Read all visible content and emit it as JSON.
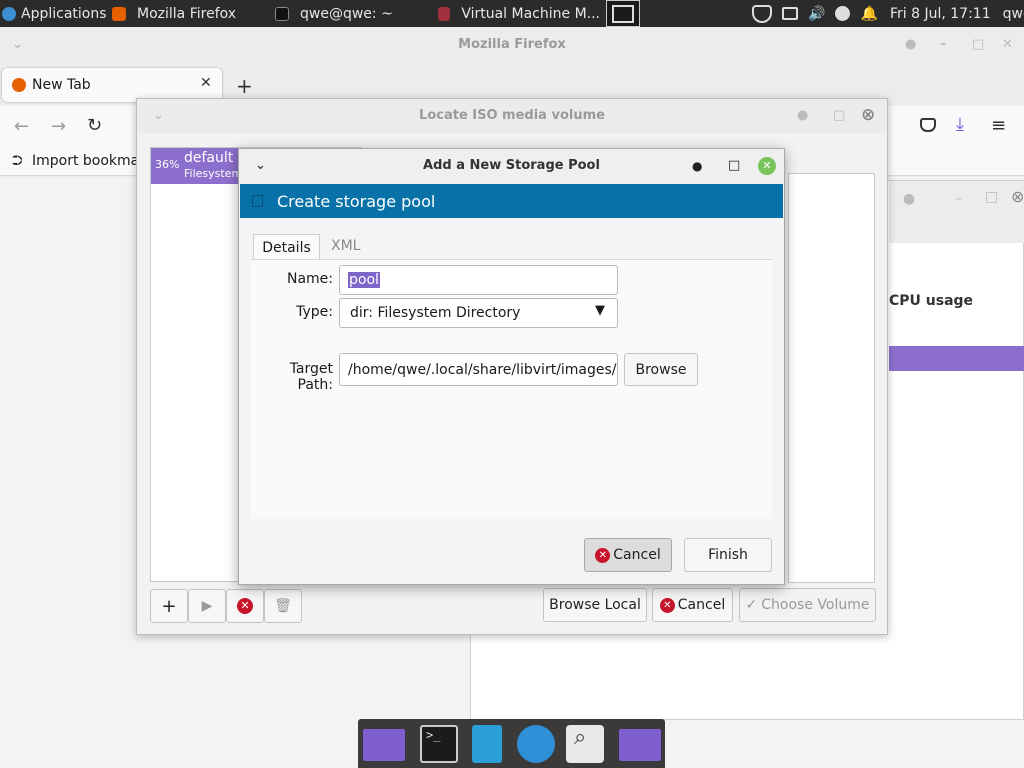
{
  "top_panel": {
    "applications": "Applications",
    "windows": [
      "Mozilla Firefox",
      "qwe@qwe: ~",
      "Virtual Machine M..."
    ],
    "clock": "Fri  8 Jul, 17:11",
    "user": "qwe"
  },
  "firefox": {
    "title": "Mozilla Firefox",
    "tab_title": "New Tab",
    "bookmark_import": "Import bookma"
  },
  "vmm": {
    "cpu_header": "CPU usage"
  },
  "locate_iso": {
    "title": "Locate ISO media volume",
    "pool_percent": "36%",
    "pool_name": "default",
    "pool_type": "Filesystem",
    "browse_local": "Browse Local",
    "cancel": "Cancel",
    "choose_volume": "Choose Volume"
  },
  "dialog": {
    "title": "Add a New Storage Pool",
    "header": "Create storage pool",
    "tabs": [
      "Details",
      "XML"
    ],
    "name_label": "Name:",
    "name_value": "pool",
    "type_label": "Type:",
    "type_value": "dir: Filesystem Directory",
    "target_label": "Target Path:",
    "target_value": "/home/qwe/.local/share/libvirt/images/pc",
    "browse": "Browse",
    "cancel": "Cancel",
    "finish": "Finish"
  },
  "colors": {
    "accent": "#0872a8",
    "selection": "#8c6fcc",
    "panel": "#2b2b2b"
  }
}
